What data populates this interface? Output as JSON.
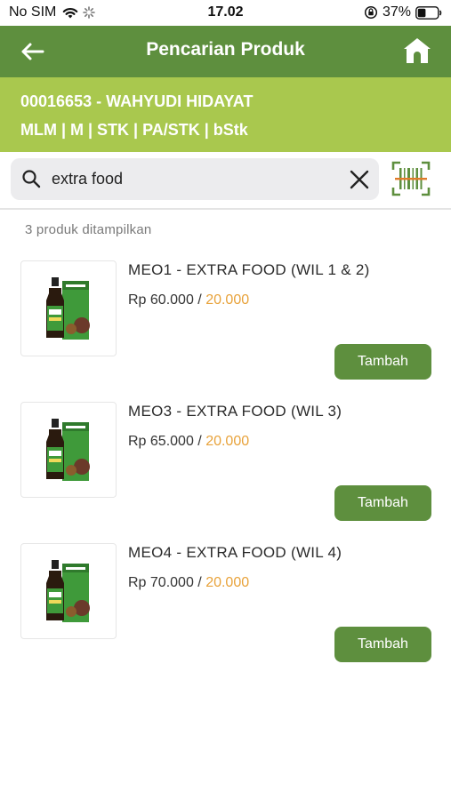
{
  "status_bar": {
    "carrier": "No SIM",
    "time": "17.02",
    "battery": "37%"
  },
  "header": {
    "title": "Pencarian Produk",
    "back_icon": "arrow-left-icon",
    "home_icon": "home-icon"
  },
  "user": {
    "name": "00016653 - WAHYUDI HIDAYAT",
    "codes": "MLM | M | STK | PA/STK | bStk"
  },
  "search": {
    "value": "extra food",
    "search_icon": "search-icon",
    "clear_icon": "close-icon",
    "barcode_icon": "barcode-scan-icon"
  },
  "results": {
    "count_text": "3  produk ditampilkan"
  },
  "products": [
    {
      "name": "MEO1 - EXTRA FOOD (WIL 1 & 2)",
      "price": "Rp 60.000",
      "separator": " / ",
      "points": "20.000",
      "button": "Tambah"
    },
    {
      "name": "MEO3 - EXTRA FOOD (WIL 3)",
      "price": "Rp 65.000",
      "separator": " / ",
      "points": "20.000",
      "button": "Tambah"
    },
    {
      "name": "MEO4 - EXTRA FOOD (WIL 4)",
      "price": "Rp 70.000",
      "separator": " / ",
      "points": "20.000",
      "button": "Tambah"
    }
  ],
  "colors": {
    "header": "#5e8f3e",
    "banner": "#a9c84e",
    "button": "#5e8f3e",
    "points": "#e8a23a",
    "barcode_accent": "#e07b2a"
  }
}
